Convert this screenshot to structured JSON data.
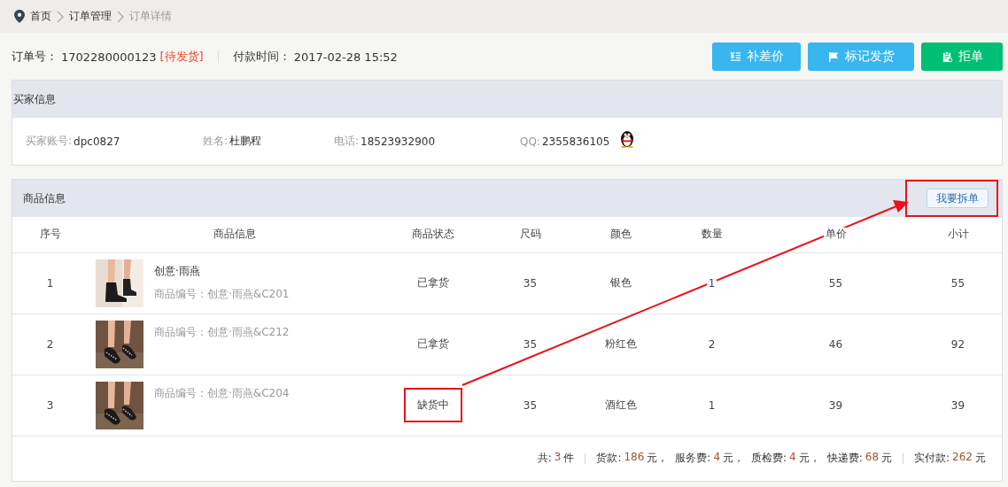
{
  "breadcrumb": [
    {
      "label": "首页",
      "current": false
    },
    {
      "label": "订单管理",
      "current": false
    },
    {
      "label": "订单详情",
      "current": true
    }
  ],
  "order": {
    "number_label": "订单号：",
    "number": "1702280000123",
    "status": "[待发货]",
    "paid_label": "付款时间：",
    "paid_time": "2017-02-28 15:52"
  },
  "actions": [
    {
      "label": "补差价",
      "kind": "price"
    },
    {
      "label": "标记发货",
      "kind": "ship"
    },
    {
      "label": "拒单",
      "kind": "reject"
    }
  ],
  "buyer": {
    "title": "买家信息",
    "fields": [
      {
        "label": "买家账号:",
        "value": "dpc0827"
      },
      {
        "label": "姓名:",
        "value": "杜鹏程"
      },
      {
        "label": "电话:",
        "value": "18523932900"
      },
      {
        "label": "QQ:",
        "value": "2355836105",
        "kind": "qq"
      }
    ]
  },
  "products": {
    "title": "商品信息",
    "split_button": {
      "label": "我要拆单",
      "highlighted": true
    },
    "columns": [
      "序号",
      "商品信息",
      "商品状态",
      "尺码",
      "颜色",
      "数量",
      "单价",
      "小计"
    ],
    "rows": [
      {
        "index": "1",
        "name": "创意·雨燕",
        "code": "商品编号：创意·雨燕&C201",
        "status": "已拿货",
        "status_highlighted": false,
        "size": "35",
        "color_name": "银色",
        "quantity": "1",
        "price": "55",
        "subtotal": "55"
      },
      {
        "index": "2",
        "code": "商品编号：创意·雨燕&C212",
        "status": "已拿货",
        "status_highlighted": false,
        "size": "35",
        "color_name": "粉红色",
        "quantity": "2",
        "price": "46",
        "subtotal": "92"
      },
      {
        "index": "3",
        "code": "商品编号：创意·雨燕&C204",
        "status": "缺货中",
        "status_highlighted": true,
        "size": "35",
        "color_name": "酒红色",
        "quantity": "1",
        "price": "39",
        "subtotal": "39"
      }
    ],
    "summary": [
      [
        {
          "label": "共:",
          "value": "3",
          "unit": "件"
        }
      ],
      [
        {
          "label": "货款:",
          "value": "186",
          "unit": "元，"
        },
        {
          "label": "服务费:",
          "value": "4",
          "unit": "元，"
        },
        {
          "label": "质检费:",
          "value": "4",
          "unit": "元，"
        },
        {
          "label": "快递费:",
          "value": "68",
          "unit": "元"
        }
      ],
      [
        {
          "label": "实付款:",
          "value": "262",
          "unit": "元"
        }
      ]
    ]
  },
  "annotation_arrow": true
}
